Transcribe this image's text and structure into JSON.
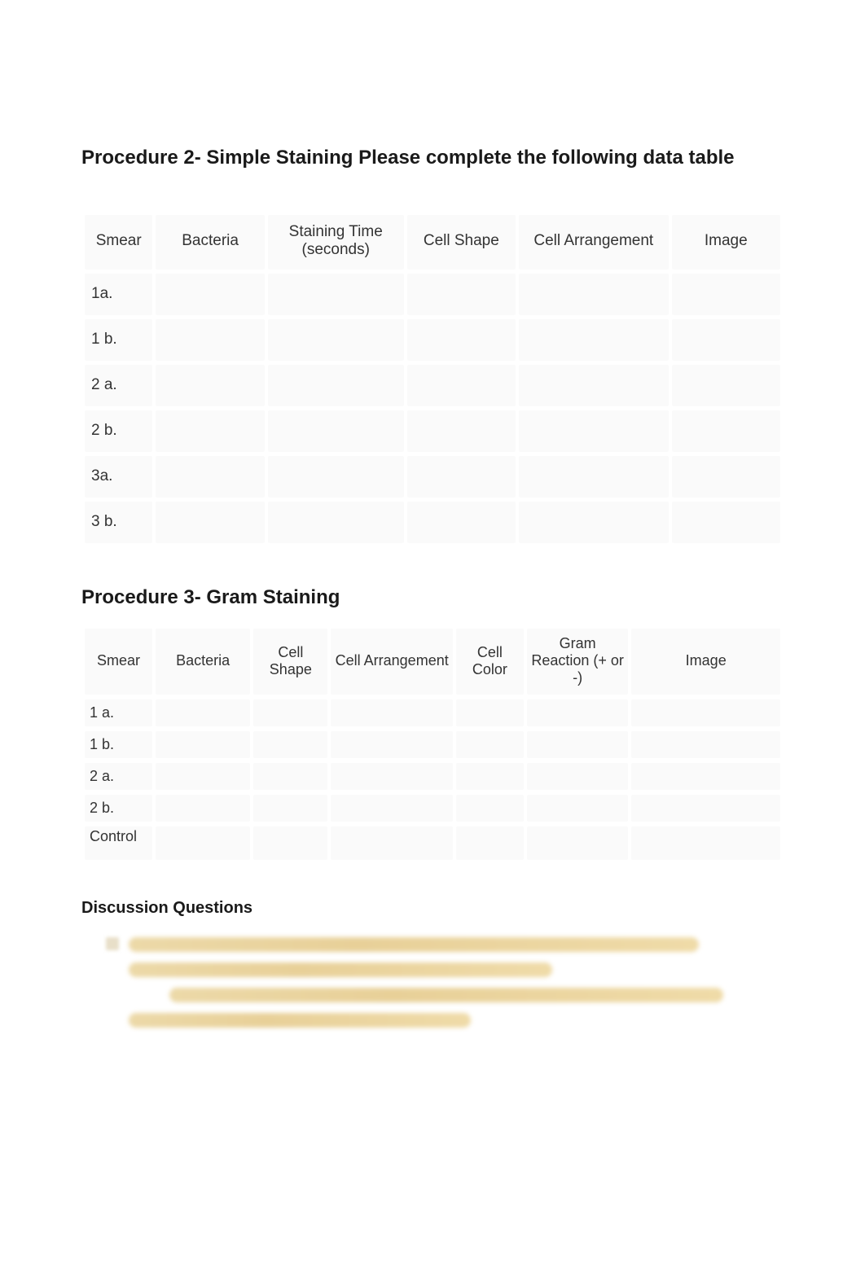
{
  "procedure2": {
    "title": "Procedure 2- Simple Staining Please complete the following data table",
    "headers": {
      "smear": "Smear",
      "bacteria": "Bacteria",
      "staining_time": "Staining Time (seconds)",
      "cell_shape": "Cell Shape",
      "cell_arrangement": "Cell Arrangement",
      "image": "Image"
    },
    "rows": [
      {
        "smear": "1a.",
        "bacteria": "",
        "staining_time": "",
        "cell_shape": "",
        "cell_arrangement": "",
        "image": ""
      },
      {
        "smear": "1 b.",
        "bacteria": "",
        "staining_time": "",
        "cell_shape": "",
        "cell_arrangement": "",
        "image": ""
      },
      {
        "smear": "2 a.",
        "bacteria": "",
        "staining_time": "",
        "cell_shape": "",
        "cell_arrangement": "",
        "image": ""
      },
      {
        "smear": "2 b.",
        "bacteria": "",
        "staining_time": "",
        "cell_shape": "",
        "cell_arrangement": "",
        "image": ""
      },
      {
        "smear": "3a.",
        "bacteria": "",
        "staining_time": "",
        "cell_shape": "",
        "cell_arrangement": "",
        "image": ""
      },
      {
        "smear": "3 b.",
        "bacteria": "",
        "staining_time": "",
        "cell_shape": "",
        "cell_arrangement": "",
        "image": ""
      }
    ]
  },
  "procedure3": {
    "title": "Procedure 3- Gram Staining",
    "headers": {
      "smear": "Smear",
      "bacteria": "Bacteria",
      "cell_shape": "Cell Shape",
      "cell_arrangement": "Cell Arrangement",
      "cell_color": "Cell Color",
      "gram_reaction": "Gram Reaction (+ or -)",
      "image": "Image"
    },
    "rows": [
      {
        "smear": "1 a.",
        "bacteria": "",
        "cell_shape": "",
        "cell_arrangement": "",
        "cell_color": "",
        "gram_reaction": "",
        "image": ""
      },
      {
        "smear": "1 b.",
        "bacteria": "",
        "cell_shape": "",
        "cell_arrangement": "",
        "cell_color": "",
        "gram_reaction": "",
        "image": ""
      },
      {
        "smear": "2 a.",
        "bacteria": "",
        "cell_shape": "",
        "cell_arrangement": "",
        "cell_color": "",
        "gram_reaction": "",
        "image": ""
      },
      {
        "smear": "2 b.",
        "bacteria": "",
        "cell_shape": "",
        "cell_arrangement": "",
        "cell_color": "",
        "gram_reaction": "",
        "image": ""
      },
      {
        "smear": "Control",
        "bacteria": "",
        "cell_shape": "",
        "cell_arrangement": "",
        "cell_color": "",
        "gram_reaction": "",
        "image": ""
      }
    ]
  },
  "discussion": {
    "title": "Discussion Questions"
  }
}
